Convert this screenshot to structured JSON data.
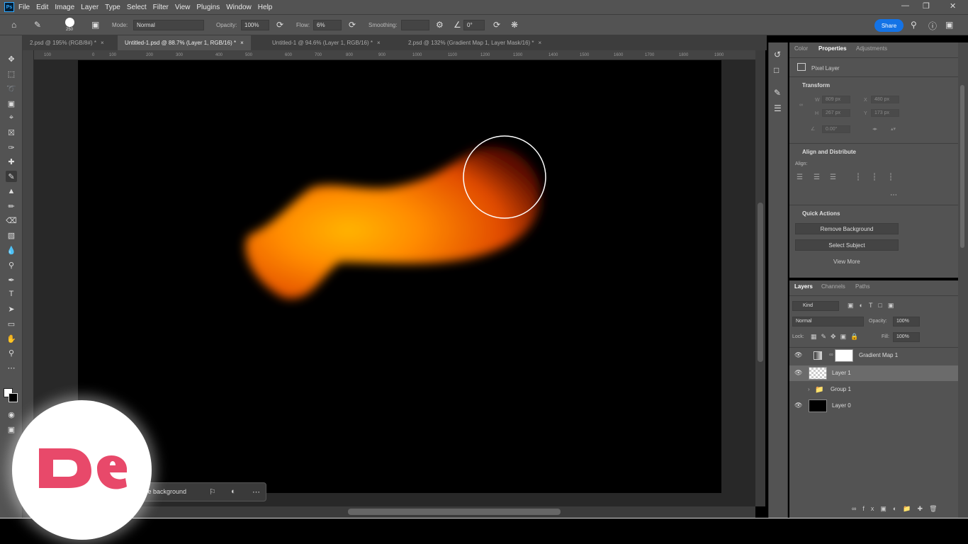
{
  "app": {
    "logo_text": "Ps"
  },
  "menu": [
    "File",
    "Edit",
    "Image",
    "Layer",
    "Type",
    "Select",
    "Filter",
    "View",
    "Plugins",
    "Window",
    "Help"
  ],
  "options": {
    "brush_size": "250",
    "mode_label": "Mode:",
    "mode_value": "Normal",
    "opacity_label": "Opacity:",
    "opacity_value": "100%",
    "flow_label": "Flow:",
    "flow_value": "6%",
    "smoothing_label": "Smoothing:",
    "angle_value": "0°",
    "share_label": "Share"
  },
  "tabs": [
    {
      "label": "2.psd @ 195% (RGB/8#) *"
    },
    {
      "label": "Untitled-1.psd @ 88.7% (Layer 1, RGB/16) *"
    },
    {
      "label": "Untitled-1 @ 94.6% (Layer 1, RGB/16) *"
    },
    {
      "label": "2.psd @ 132% (Gradient Map 1, Layer Mask/16) *"
    }
  ],
  "ruler_h": [
    "100",
    "0",
    "100",
    "200",
    "300",
    "400",
    "500",
    "600",
    "700",
    "800",
    "900",
    "1000",
    "1100",
    "1200",
    "1300",
    "1400",
    "1500",
    "1600",
    "1700",
    "1800",
    "1900"
  ],
  "taskbar": {
    "label": "ve background"
  },
  "properties": {
    "tabs": [
      "Color",
      "Properties",
      "Adjustments"
    ],
    "layer_kind": "Pixel Layer",
    "transform_title": "Transform",
    "w_label": "W",
    "h_label": "H",
    "x_label": "X",
    "y_label": "Y",
    "w_value": "809 px",
    "h_value": "267 px",
    "x_value": "480 px",
    "y_value": "173 px",
    "angle_value": "0.00°",
    "align_title": "Align and Distribute",
    "align_label": "Align:",
    "quick_title": "Quick Actions",
    "remove_bg": "Remove Background",
    "select_subject": "Select Subject",
    "view_more": "View More"
  },
  "layers_panel": {
    "tabs": [
      "Layers",
      "Channels",
      "Paths"
    ],
    "kind_label": "Kind",
    "blend_mode": "Normal",
    "opacity_label": "Opacity:",
    "opacity_value": "100%",
    "lock_label": "Lock:",
    "fill_label": "Fill:",
    "fill_value": "100%",
    "layers": [
      {
        "name": "Gradient Map 1"
      },
      {
        "name": "Layer 1"
      },
      {
        "name": "Group 1"
      },
      {
        "name": "Layer 0"
      }
    ]
  },
  "colors": {
    "accent": "#1473e6",
    "logo_pink": "#e8496a",
    "stroke_orange": "#ff8a00"
  }
}
